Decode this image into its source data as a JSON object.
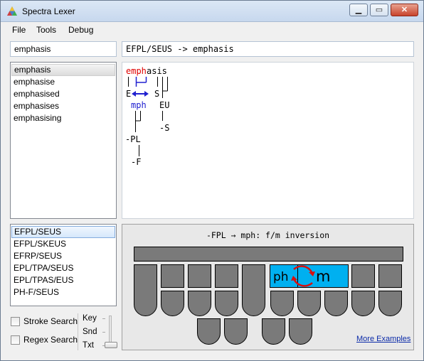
{
  "window": {
    "title": "Spectra Lexer"
  },
  "menu": {
    "items": [
      "File",
      "Tools",
      "Debug"
    ]
  },
  "search": {
    "query": "emphasis"
  },
  "translation": {
    "text": "EFPL/SEUS -> emphasis"
  },
  "words": [
    "emphasis",
    "emphasise",
    "emphasised",
    "emphasises",
    "emphasising"
  ],
  "strokes": [
    "EFPL/SEUS",
    "EFPL/SKEUS",
    "EFRP/SEUS",
    "EPL/TPA/SEUS",
    "EPL/TPAS/EUS",
    "PH-F/SEUS"
  ],
  "graph": {
    "word_red": "emph",
    "word_rest": "asis",
    "e_key": "E",
    "s_key": "S",
    "mph": "mph",
    "eu_key": "EU",
    "s_final": "-S",
    "pl_key": "-PL",
    "f_key": "-F"
  },
  "board": {
    "caption": "-FPL → mph: f/m inversion",
    "ph_label": "ph",
    "m_label": "m",
    "more_examples": "More Examples"
  },
  "options": {
    "stroke_search": "Stroke Search",
    "regex_search": "Regex Search"
  },
  "slider": {
    "labels": [
      "Key",
      "Snd",
      "Txt"
    ],
    "selected": "Txt"
  },
  "colors": {
    "highlight_red": "#e00000",
    "highlight_blue": "#2020d0",
    "key_active": "#00b0f0",
    "key_idle": "#7a7a7a",
    "arrow_red": "#d81010"
  }
}
